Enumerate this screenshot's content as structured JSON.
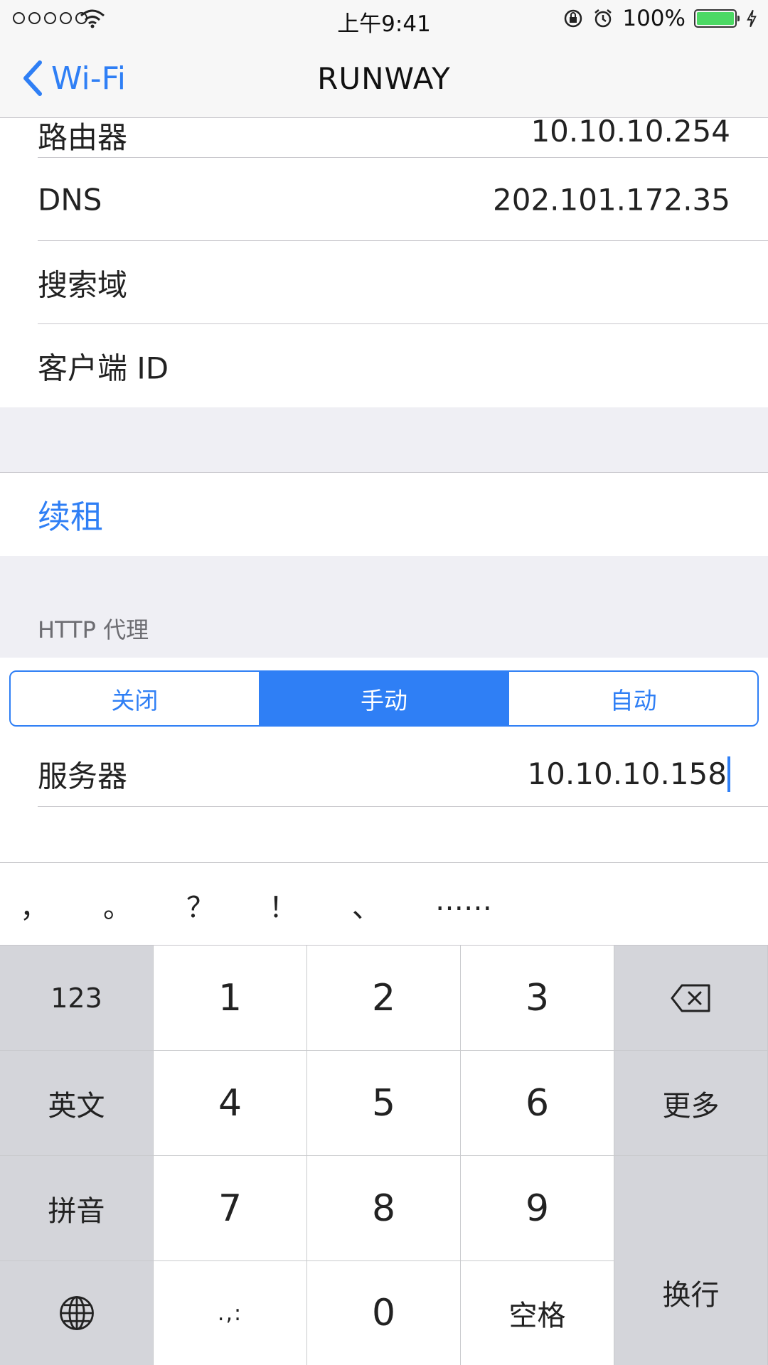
{
  "status_bar": {
    "time": "上午9:41",
    "battery": "100%",
    "icons": [
      "signal-dots-icon",
      "wifi-icon",
      "rotation-lock-icon",
      "alarm-icon",
      "battery-icon",
      "charging-bolt-icon"
    ]
  },
  "nav": {
    "back_label": "Wi-Fi",
    "title": "RUNWAY"
  },
  "rows": {
    "router": {
      "label": "路由器",
      "value": "10.10.10.254"
    },
    "dns": {
      "label": "DNS",
      "value": "202.101.172.35"
    },
    "search_domain": {
      "label": "搜索域",
      "value": ""
    },
    "client_id": {
      "label": "客户端 ID",
      "value": ""
    }
  },
  "renew_lease": "续租",
  "http_proxy": {
    "header": "HTTP 代理",
    "segments": [
      "关闭",
      "手动",
      "自动"
    ],
    "selected": "手动",
    "server_label": "服务器",
    "server_value": "10.10.10.158"
  },
  "keyboard": {
    "candidates": [
      "，",
      "。",
      "？",
      "！",
      "、",
      "……"
    ],
    "rows": [
      [
        "123",
        "1",
        "2",
        "3",
        "delete"
      ],
      [
        "英文",
        "4",
        "5",
        "6",
        "更多"
      ],
      [
        "拼音",
        "7",
        "8",
        "9",
        "换行"
      ],
      [
        "globe",
        ".,:",
        "0",
        "空格"
      ]
    ],
    "keys": {
      "mode_123": "123",
      "english": "英文",
      "pinyin": "拼音",
      "more": "更多",
      "return": "换行",
      "punct": ".,:",
      "space": "空格",
      "d1": "1",
      "d2": "2",
      "d3": "3",
      "d4": "4",
      "d5": "5",
      "d6": "6",
      "d7": "7",
      "d8": "8",
      "d9": "9",
      "d0": "0"
    }
  },
  "colors": {
    "accent": "#2f7ff5",
    "battery": "#4cd964",
    "grouped_background": "#efeff4",
    "keyboard_function_key": "#d4d5da"
  }
}
